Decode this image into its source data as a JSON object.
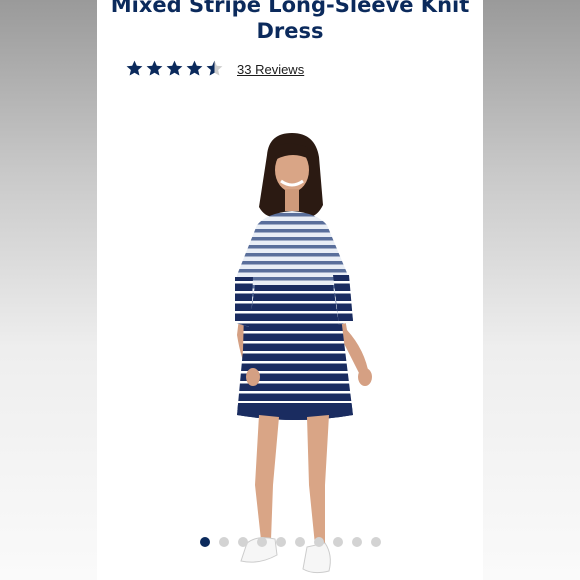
{
  "product": {
    "title_line1": "Mixed Stripe Long-Sleeve Knit",
    "title_line2": "Dress",
    "rating": 4.5,
    "rating_max": 5,
    "reviews_label": "33 Reviews",
    "image_alt": "Model wearing mixed stripe long-sleeve knit dress"
  },
  "carousel": {
    "total": 10,
    "active_index": 0
  },
  "colors": {
    "brand_navy": "#0b2a5c",
    "star_empty": "#cfcfcf",
    "dot_inactive": "#d3d3d3"
  },
  "icons": {
    "star": "star-icon"
  }
}
